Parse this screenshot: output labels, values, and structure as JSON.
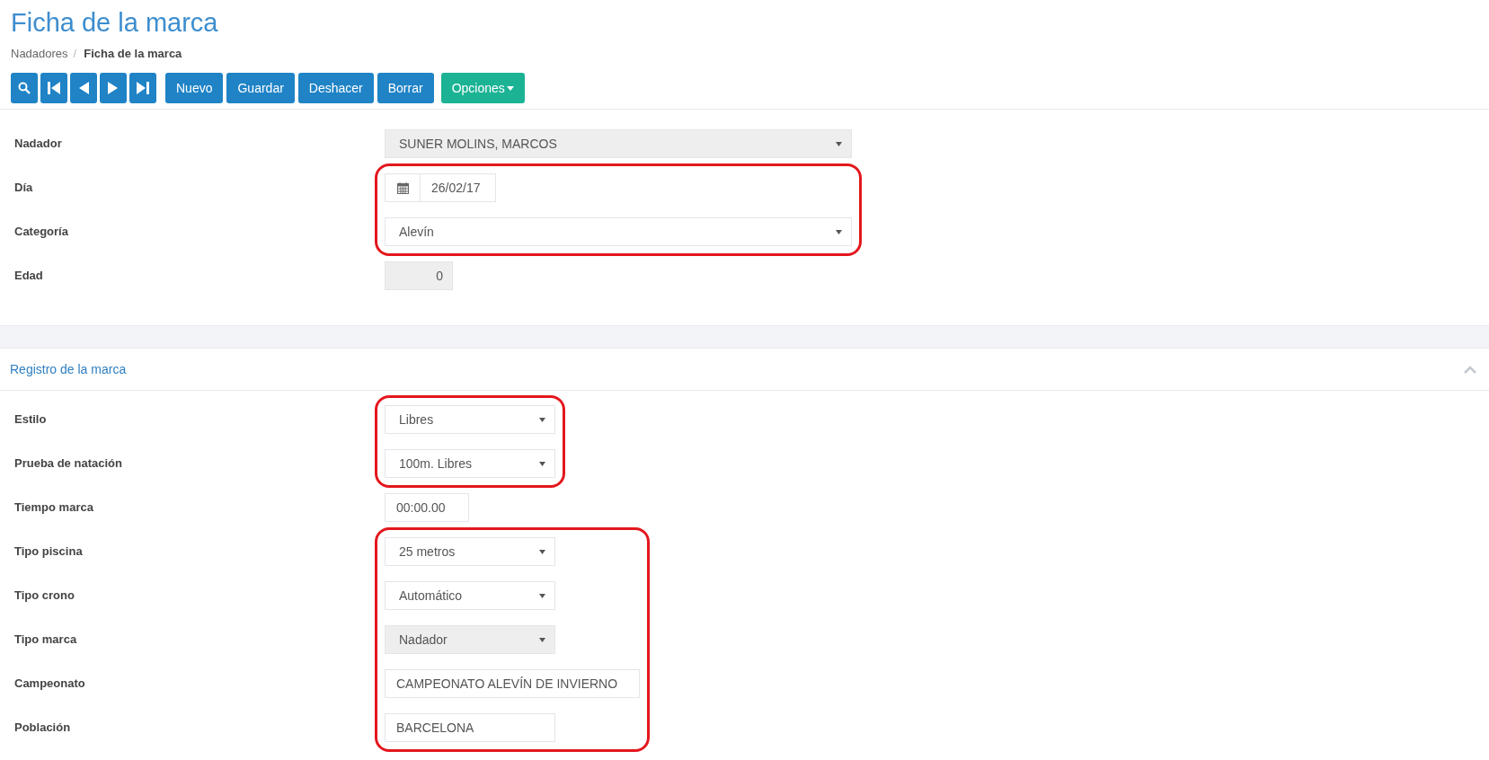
{
  "page": {
    "title": "Ficha de la marca",
    "breadcrumb_separator": "/",
    "breadcrumb": [
      {
        "label": "Nadadores",
        "current": false
      },
      {
        "label": "Ficha de la marca",
        "current": true
      }
    ]
  },
  "toolbar": {
    "nav_buttons": [
      {
        "kind": "search"
      },
      {
        "kind": "first"
      },
      {
        "kind": "previous"
      },
      {
        "kind": "next"
      },
      {
        "kind": "last"
      }
    ],
    "buttons": [
      {
        "label": "Nuevo",
        "kind": "primary"
      },
      {
        "label": "Guardar",
        "kind": "primary"
      },
      {
        "label": "Deshacer",
        "kind": "primary"
      },
      {
        "label": "Borrar",
        "kind": "primary"
      },
      {
        "label": "Opciones",
        "kind": "dropdown"
      }
    ]
  },
  "main_form": {
    "blocks": [
      {
        "highlighted": false,
        "fields": [
          {
            "label": "Nadador",
            "kind": "select",
            "value": "SUNER MOLINS, MARCOS",
            "disabled": true
          }
        ]
      },
      {
        "highlighted": true,
        "fields": [
          {
            "label": "Día",
            "kind": "date",
            "value": "26/02/17",
            "disabled": false
          },
          {
            "label": "Categoría",
            "kind": "select",
            "value": "Alevín",
            "disabled": false
          }
        ]
      },
      {
        "highlighted": false,
        "fields": [
          {
            "label": "Edad",
            "kind": "number",
            "value": "0",
            "disabled": true
          }
        ]
      }
    ]
  },
  "section": {
    "title": "Registro de la marca",
    "expanded": true,
    "blocks": [
      {
        "highlighted": true,
        "fields": [
          {
            "label": "Estilo",
            "kind": "select",
            "value": "Libres",
            "disabled": false
          },
          {
            "label": "Prueba de natación",
            "kind": "select",
            "value": "100m. Libres",
            "disabled": false
          }
        ]
      },
      {
        "highlighted": false,
        "fields": [
          {
            "label": "Tiempo marca",
            "kind": "text",
            "value": "00:00.00",
            "disabled": false
          }
        ]
      },
      {
        "highlighted": true,
        "fields": [
          {
            "label": "Tipo piscina",
            "kind": "select",
            "value": "25 metros",
            "disabled": false
          },
          {
            "label": "Tipo crono",
            "kind": "select",
            "value": "Automático",
            "disabled": false
          },
          {
            "label": "Tipo marca",
            "kind": "select",
            "value": "Nadador",
            "disabled": true
          },
          {
            "label": "Campeonato",
            "kind": "text",
            "value": "CAMPEONATO ALEVÍN DE INVIERNO",
            "disabled": false
          },
          {
            "label": "Población",
            "kind": "text",
            "value": "BARCELONA",
            "disabled": false
          }
        ]
      }
    ]
  }
}
